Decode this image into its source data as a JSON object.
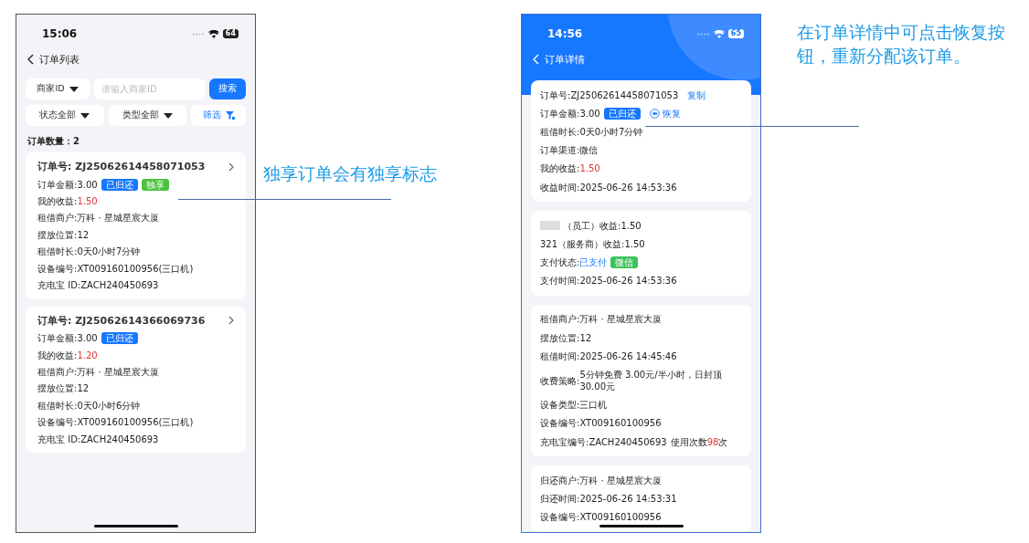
{
  "list_screen": {
    "status_bar": {
      "time": "15:06",
      "battery": "64"
    },
    "title": "订单列表",
    "merchant_select": "商家ID",
    "search_placeholder": "请输入商家ID",
    "search_button": "搜索",
    "status_select": "状态全部",
    "type_select": "类型全部",
    "filter_button": "筛选",
    "count": "订单数量：2",
    "orders": [
      {
        "order_no": "订单号: ZJ25062614458071053",
        "rows": [
          {
            "label": "订单金额: ",
            "value": "3.00",
            "kind": "plain",
            "tags": [
              {
                "text": "已归还",
                "color": "#1677ff"
              },
              {
                "text": "独享",
                "color": "#4cc23f"
              }
            ]
          },
          {
            "label": "我的收益: ",
            "value": "1.50",
            "kind": "red"
          },
          {
            "label": "租借商户: ",
            "value": "万科 · 星城星宸大厦",
            "kind": "plain"
          },
          {
            "label": "摆放位置: ",
            "value": "12",
            "kind": "plain"
          },
          {
            "label": "租借时长: ",
            "value": "0天0小时7分钟",
            "kind": "plain"
          },
          {
            "label": "设备编号: ",
            "value": "XT009160100956(三口机)",
            "kind": "plain"
          },
          {
            "label": "充电宝 ID: ",
            "value": "ZACH240450693",
            "kind": "plain"
          }
        ]
      },
      {
        "order_no": "订单号: ZJ25062614366069736",
        "rows": [
          {
            "label": "订单金额: ",
            "value": "3.00",
            "kind": "plain",
            "tags": [
              {
                "text": "已归还",
                "color": "#1677ff"
              }
            ]
          },
          {
            "label": "我的收益: ",
            "value": "1.20",
            "kind": "red"
          },
          {
            "label": "租借商户: ",
            "value": "万科 · 星城星宸大厦",
            "kind": "plain"
          },
          {
            "label": "摆放位置: ",
            "value": "12",
            "kind": "plain"
          },
          {
            "label": "租借时长: ",
            "value": "0天0小时6分钟",
            "kind": "plain"
          },
          {
            "label": "设备编号: ",
            "value": "XT009160100956(三口机)",
            "kind": "plain"
          },
          {
            "label": "充电宝 ID: ",
            "value": "ZACH240450693",
            "kind": "plain"
          }
        ]
      }
    ]
  },
  "detail_screen": {
    "status_bar": {
      "time": "14:56",
      "battery": "65"
    },
    "title": "订单详情",
    "sections": [
      {
        "rows": [
          {
            "label": "订单号: ",
            "value": "ZJ25062614458071053",
            "kind": "plain",
            "link": "复制"
          },
          {
            "label": "订单金额: ",
            "value": "3.00",
            "kind": "plain",
            "tags": [
              {
                "text": "已归还",
                "color": "#1677ff"
              }
            ],
            "action": "恢复"
          },
          {
            "label": "租借时长: ",
            "value": "0天0小时7分钟",
            "kind": "plain"
          },
          {
            "label": "订单渠道: ",
            "value": "微信",
            "kind": "plain"
          },
          {
            "label": "我的收益: ",
            "value": "1.50",
            "kind": "red"
          },
          {
            "label": "收益时间: ",
            "value": "2025-06-26 14:53:36",
            "kind": "plain"
          }
        ]
      },
      {
        "rows": [
          {
            "label": "（员工）收益: ",
            "value": "1.50",
            "kind": "plain",
            "redacted": true
          },
          {
            "label": "321（服务商）收益: ",
            "value": "1.50",
            "kind": "plain"
          },
          {
            "label": "支付状态: ",
            "value": "已支付",
            "kind": "blue",
            "tags": [
              {
                "text": "微信",
                "color": "#3cc35a"
              }
            ]
          },
          {
            "label": "支付时间: ",
            "value": "2025-06-26 14:53:36",
            "kind": "plain"
          }
        ]
      },
      {
        "rows": [
          {
            "label": "租借商户: ",
            "value": "万科 · 星城星宸大厦",
            "kind": "plain"
          },
          {
            "label": "摆放位置: ",
            "value": "12",
            "kind": "plain"
          },
          {
            "label": "租借时间: ",
            "value": "2025-06-26 14:45:46",
            "kind": "plain"
          },
          {
            "label": "收费策略: ",
            "value": "5分钟免费 3.00元/半小时，日封顶30.00元",
            "kind": "plain"
          },
          {
            "label": "设备类型: ",
            "value": "三口机",
            "kind": "plain"
          },
          {
            "label": "设备编号: ",
            "value": "XT009160100956",
            "kind": "plain"
          },
          {
            "label": "充电宝编号: ",
            "value": "ZACH240450693",
            "kind": "plain",
            "usage": {
              "prefix": "使用次数",
              "count": "98",
              "suffix": "次"
            }
          }
        ]
      },
      {
        "rows": [
          {
            "label": "归还商户: ",
            "value": "万科 · 星城星宸大厦",
            "kind": "plain"
          },
          {
            "label": "归还时间: ",
            "value": "2025-06-26 14:53:31",
            "kind": "plain"
          },
          {
            "label": "设备编号: ",
            "value": "XT009160100956",
            "kind": "plain"
          }
        ]
      }
    ]
  },
  "annotations": [
    {
      "text": "独享订单会有独享标志"
    },
    {
      "text": "在订单详情中可点击恢复按钮，重新分配该订单。"
    }
  ]
}
